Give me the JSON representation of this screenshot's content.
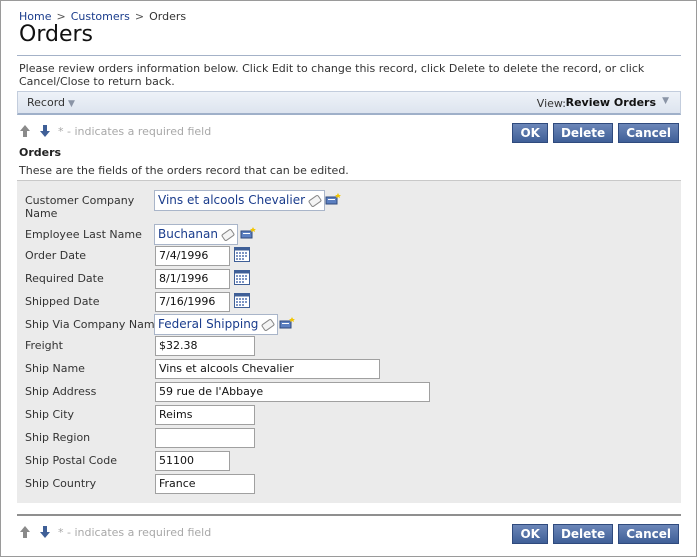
{
  "breadcrumb": {
    "home": "Home",
    "customers": "Customers",
    "orders": "Orders",
    "sep": ">"
  },
  "page": {
    "title": "Orders",
    "description": "Please review orders information below. Click Edit to change this record, click Delete to delete the record, or click Cancel/Close to return back."
  },
  "actionbar": {
    "record_label": "Record",
    "view_label": "View:",
    "view_value": "Review Orders"
  },
  "toolbar": {
    "required_note": "* - indicates a required field",
    "ok": "OK",
    "delete": "Delete",
    "cancel": "Cancel"
  },
  "category": {
    "title": "Orders",
    "description": "These are the fields of the orders record that can be edited."
  },
  "fields": {
    "customer_company_name": {
      "label": "Customer Company Name",
      "value": "Vins et alcools Chevalier"
    },
    "employee_last_name": {
      "label": "Employee Last Name",
      "value": "Buchanan"
    },
    "order_date": {
      "label": "Order Date",
      "value": "7/4/1996"
    },
    "required_date": {
      "label": "Required Date",
      "value": "8/1/1996"
    },
    "shipped_date": {
      "label": "Shipped Date",
      "value": "7/16/1996"
    },
    "ship_via_company_name": {
      "label": "Ship Via Company Name",
      "value": "Federal Shipping"
    },
    "freight": {
      "label": "Freight",
      "value": "$32.38"
    },
    "ship_name": {
      "label": "Ship Name",
      "value": "Vins et alcools Chevalier"
    },
    "ship_address": {
      "label": "Ship Address",
      "value": "59 rue de l'Abbaye"
    },
    "ship_city": {
      "label": "Ship City",
      "value": "Reims"
    },
    "ship_region": {
      "label": "Ship Region",
      "value": ""
    },
    "ship_postal_code": {
      "label": "Ship Postal Code",
      "value": "51100"
    },
    "ship_country": {
      "label": "Ship Country",
      "value": "France"
    }
  },
  "colors": {
    "link": "#1a3c8c",
    "button": "#4a679e",
    "form_bg": "#ebebeb"
  }
}
